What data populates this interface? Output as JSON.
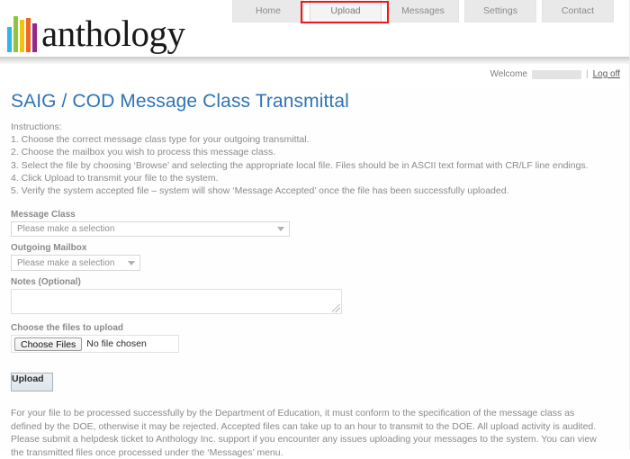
{
  "header": {
    "logo_text": "anthology",
    "logo_bars": [
      {
        "name": "bar-blue",
        "color": "#2eb6e8"
      },
      {
        "name": "bar-green",
        "color": "#8ec63f"
      },
      {
        "name": "bar-yellow",
        "color": "#f3c20b"
      },
      {
        "name": "bar-orange",
        "color": "#f26522"
      },
      {
        "name": "bar-purple",
        "color": "#92278f"
      }
    ],
    "nav": [
      {
        "label": "Home",
        "active": false
      },
      {
        "label": "Upload",
        "active": true
      },
      {
        "label": "Messages",
        "active": false
      },
      {
        "label": "Settings",
        "active": false
      },
      {
        "label": "Contact",
        "active": false
      }
    ],
    "annotation_color": "#f01616"
  },
  "account": {
    "welcome_label": "Welcome",
    "username_redacted": "",
    "separator": "|",
    "logoff_label": "Log off"
  },
  "main": {
    "title": "SAIG / COD Message Class Transmittal",
    "instructions_heading": "Instructions:",
    "instructions": [
      "1. Choose the correct message class type for your outgoing transmittal.",
      "2. Choose the mailbox you wish to process this message class.",
      "3. Select the file by choosing ‘Browse’ and selecting the appropriate local file. Files should be in ASCII text format with CR/LF line endings.",
      "4. Click Upload to transmit your file to the system.",
      "5. Verify the system accepted file – system will show ‘Message Accepted’ once the file has been successfully uploaded."
    ]
  },
  "form": {
    "message_class": {
      "label": "Message Class",
      "value": "Please make a selection"
    },
    "outgoing_mailbox": {
      "label": "Outgoing Mailbox",
      "value": "Please make a selection"
    },
    "notes": {
      "label": "Notes (Optional)",
      "value": "",
      "placeholder": ""
    },
    "file_upload": {
      "label": "Choose the files to upload",
      "button_label": "Choose Files",
      "status": "No file chosen"
    },
    "submit_label": "Upload"
  },
  "footer": {
    "note": "For your file to be processed successfully by the Department of Education, it must conform to the specification of the message class as defined by the DOE, otherwise it may be rejected. Accepted files can take up to an hour to transmit to the DOE. All upload activity is audited. Please submit a helpdesk ticket to Anthology Inc. support if you encounter any issues uploading your messages to the system. You can view the transmitted files once processed under the ‘Messages’ menu."
  }
}
